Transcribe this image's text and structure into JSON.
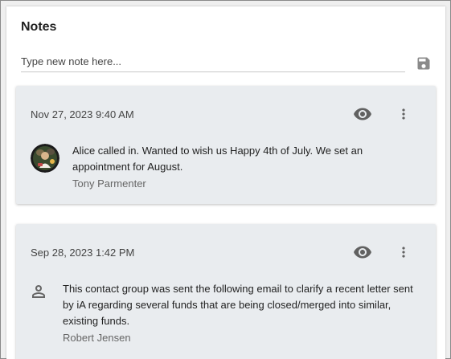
{
  "notes_panel": {
    "title": "Notes",
    "new_note_placeholder": "Type new note here...",
    "save_icon": "save-icon"
  },
  "notes": [
    {
      "date": "Nov 27, 2023 9:40 AM",
      "text": "Alice called in. Wanted to wish us Happy 4th of July. We set an appointment for August.",
      "author": "Tony Parmenter",
      "avatar": "photo"
    },
    {
      "date": "Sep 28, 2023 1:42 PM",
      "text": "This contact group was sent the following email to clarify a recent letter sent by iA regarding several funds that are being closed/merged into similar, existing funds.",
      "author": "Robert Jensen",
      "avatar": "person-icon"
    }
  ],
  "colors": {
    "card_background": "#e9ecef",
    "icon": "#616161"
  }
}
